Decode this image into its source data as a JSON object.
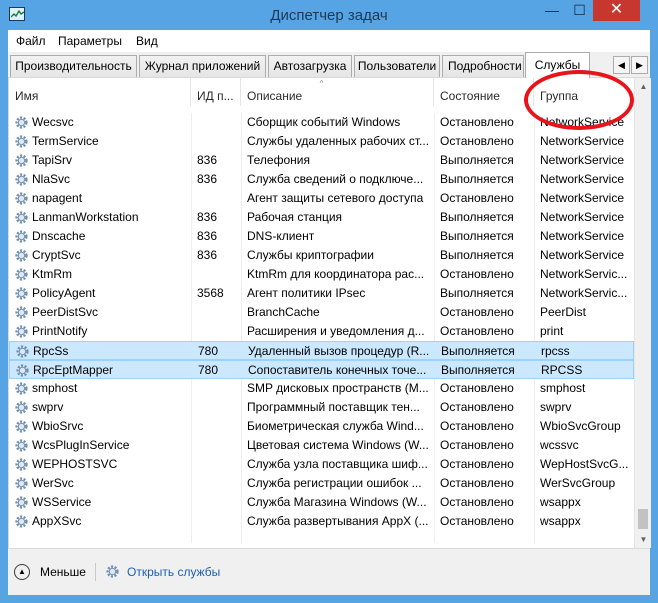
{
  "window": {
    "title": "Диспетчер задач",
    "minimize": "—",
    "maximize": "☐",
    "close": "✕"
  },
  "menu": [
    "Файл",
    "Параметры",
    "Вид"
  ],
  "tabs": [
    "Производительность",
    "Журнал приложений",
    "Автозагрузка",
    "Пользователи",
    "Подробности",
    "Службы"
  ],
  "tab_scroll": {
    "left": "◀",
    "right": "▶"
  },
  "columns": {
    "name": "Имя",
    "pid": "ИД п...",
    "desc": "Описание",
    "status": "Состояние",
    "group": "Группа",
    "sort_caret": "^"
  },
  "services": [
    {
      "name": "Wecsvc",
      "pid": "",
      "desc": "Сборщик событий Windows",
      "status": "Остановлено",
      "group": "NetworkService"
    },
    {
      "name": "TermService",
      "pid": "",
      "desc": "Службы удаленных рабочих ст...",
      "status": "Остановлено",
      "group": "NetworkService"
    },
    {
      "name": "TapiSrv",
      "pid": "836",
      "desc": "Телефония",
      "status": "Выполняется",
      "group": "NetworkService"
    },
    {
      "name": "NlaSvc",
      "pid": "836",
      "desc": "Служба сведений о подключе...",
      "status": "Выполняется",
      "group": "NetworkService"
    },
    {
      "name": "napagent",
      "pid": "",
      "desc": "Агент защиты сетевого доступа",
      "status": "Остановлено",
      "group": "NetworkService"
    },
    {
      "name": "LanmanWorkstation",
      "pid": "836",
      "desc": "Рабочая станция",
      "status": "Выполняется",
      "group": "NetworkService"
    },
    {
      "name": "Dnscache",
      "pid": "836",
      "desc": "DNS-клиент",
      "status": "Выполняется",
      "group": "NetworkService"
    },
    {
      "name": "CryptSvc",
      "pid": "836",
      "desc": "Службы криптографии",
      "status": "Выполняется",
      "group": "NetworkService"
    },
    {
      "name": "KtmRm",
      "pid": "",
      "desc": "KtmRm для координатора рас...",
      "status": "Остановлено",
      "group": "NetworkServic..."
    },
    {
      "name": "PolicyAgent",
      "pid": "3568",
      "desc": "Агент политики IPsec",
      "status": "Выполняется",
      "group": "NetworkServic..."
    },
    {
      "name": "PeerDistSvc",
      "pid": "",
      "desc": "BranchCache",
      "status": "Остановлено",
      "group": "PeerDist"
    },
    {
      "name": "PrintNotify",
      "pid": "",
      "desc": "Расширения и уведомления д...",
      "status": "Остановлено",
      "group": "print"
    },
    {
      "name": "RpcSs",
      "pid": "780",
      "desc": "Удаленный вызов процедур (R...",
      "status": "Выполняется",
      "group": "rpcss",
      "selected": true
    },
    {
      "name": "RpcEptMapper",
      "pid": "780",
      "desc": "Сопоставитель конечных точе...",
      "status": "Выполняется",
      "group": "RPCSS",
      "selected": true
    },
    {
      "name": "smphost",
      "pid": "",
      "desc": "SMP дисковых пространств (М...",
      "status": "Остановлено",
      "group": "smphost"
    },
    {
      "name": "swprv",
      "pid": "",
      "desc": "Программный поставщик тен...",
      "status": "Остановлено",
      "group": "swprv"
    },
    {
      "name": "WbioSrvc",
      "pid": "",
      "desc": "Биометрическая служба Wind...",
      "status": "Остановлено",
      "group": "WbioSvcGroup"
    },
    {
      "name": "WcsPlugInService",
      "pid": "",
      "desc": "Цветовая система Windows (W...",
      "status": "Остановлено",
      "group": "wcssvc"
    },
    {
      "name": "WEPHOSTSVC",
      "pid": "",
      "desc": "Служба узла поставщика шиф...",
      "status": "Остановлено",
      "group": "WepHostSvcG..."
    },
    {
      "name": "WerSvc",
      "pid": "",
      "desc": "Служба регистрации ошибок ...",
      "status": "Остановлено",
      "group": "WerSvcGroup"
    },
    {
      "name": "WSService",
      "pid": "",
      "desc": "Служба Магазина Windows (W...",
      "status": "Остановлено",
      "group": "wsappx"
    },
    {
      "name": "AppXSvc",
      "pid": "",
      "desc": "Служба развертывания AppX (...",
      "status": "Остановлено",
      "group": "wsappx"
    }
  ],
  "footer": {
    "less": "Меньше",
    "open_services": "Открыть службы"
  },
  "colors": {
    "title_bar": "#57a4e4",
    "selection": "#cce8ff",
    "highlight": "#e8141c",
    "link": "#1a5fb4"
  }
}
